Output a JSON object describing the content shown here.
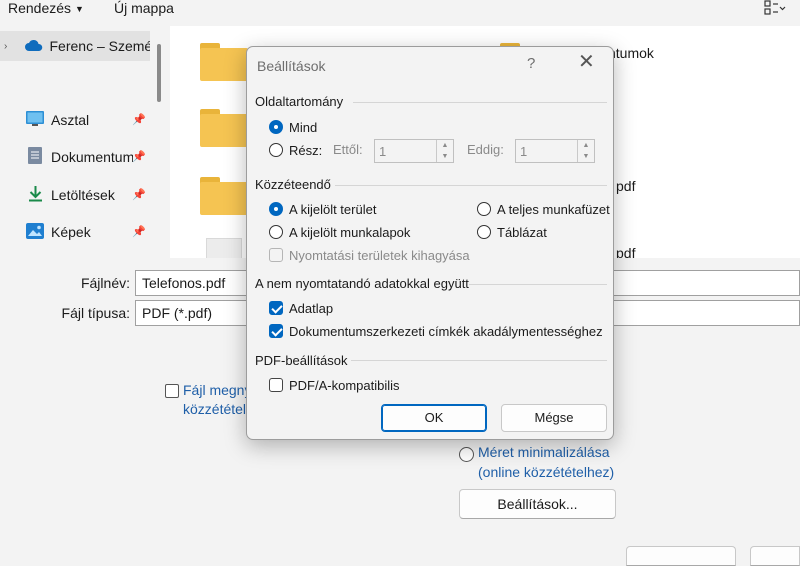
{
  "toolbar": {
    "organize_label": "Rendezés",
    "new_folder_label": "Új mappa"
  },
  "nav": {
    "items": [
      {
        "label": "Ferenc – Személ"
      },
      {
        "label": "Asztal"
      },
      {
        "label": "Dokumentum"
      },
      {
        "label": "Letöltések"
      },
      {
        "label": "Képek"
      }
    ]
  },
  "files": {
    "names": [
      "ntumok",
      "pdf",
      "pdf"
    ]
  },
  "save_form": {
    "filename_label": "Fájlnév:",
    "filename_value": "Telefonos.pdf",
    "filetype_label": "Fájl típusa:",
    "filetype_value": "PDF (*.pdf)",
    "open_after_line1": "Fájl megny",
    "open_after_line2": "közzététel",
    "minimize_line1": "Méret minimalizálása",
    "minimize_line2": "(online közzétételhez)",
    "options_button": "Beállítások..."
  },
  "dialog": {
    "title": "Beállítások",
    "help": "?",
    "close": "✕",
    "page_range": {
      "heading": "Oldaltartomány",
      "all_label": "Mind",
      "pages_label": "Rész:",
      "from_label": "Ettől:",
      "from_value": "1",
      "to_label": "Eddig:",
      "to_value": "1"
    },
    "publish_what": {
      "heading": "Közzéteendő",
      "selection": "A kijelölt terület",
      "workbook": "A teljes munkafüzet",
      "sheets": "A kijelölt munkalapok",
      "table": "Táblázat",
      "ignore_print_areas": "Nyomtatási területek kihagyása"
    },
    "non_printing": {
      "heading": "A nem nyomtatandó adatokkal együtt",
      "properties": "Adatlap",
      "doc_tags": "Dokumentumszerkezeti címkék akadálymentességhez"
    },
    "pdf_options": {
      "heading": "PDF-beállítások",
      "pdfa": "PDF/A-kompatibilis"
    },
    "ok_label": "OK",
    "cancel_label": "Mégse"
  },
  "colors": {
    "accent": "#0067c0",
    "folder": "#f5c452",
    "link": "#1f5fa8"
  }
}
